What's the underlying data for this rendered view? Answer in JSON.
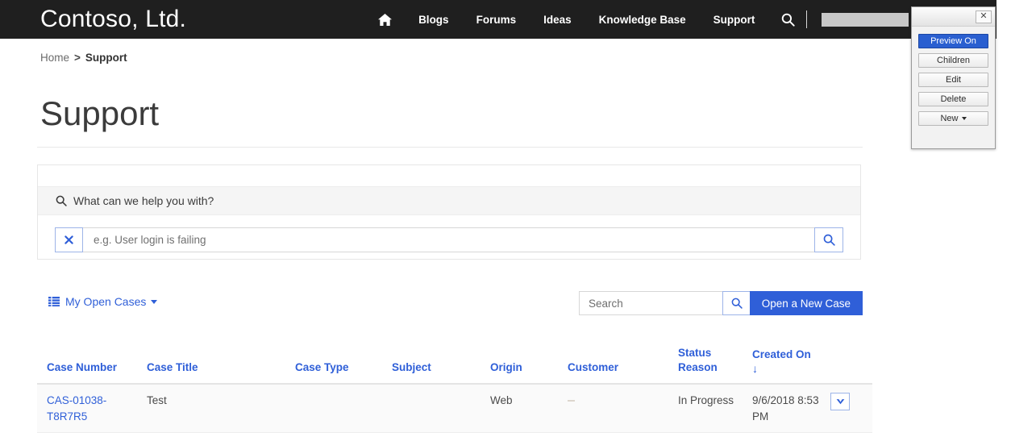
{
  "nav": {
    "brand": "Contoso, Ltd.",
    "home_icon": "home-icon",
    "links": [
      "Blogs",
      "Forums",
      "Ideas",
      "Knowledge Base",
      "Support"
    ],
    "search_icon": "search-icon",
    "user_label": "",
    "user_caret": "chevron-down-icon"
  },
  "breadcrumb": {
    "home": "Home",
    "separator": ">",
    "current": "Support"
  },
  "page": {
    "title": "Support"
  },
  "help": {
    "prompt_icon": "search-icon",
    "prompt": "What can we help you with?",
    "clear_icon": "close-x-icon",
    "input_value": "",
    "input_placeholder": "e.g. User login is failing",
    "search_icon": "search-icon"
  },
  "toolbar": {
    "view_icon": "list-icon",
    "view_label": "My Open Cases",
    "view_caret": "caret-down-icon",
    "search_value": "",
    "search_placeholder": "Search",
    "search_icon": "search-icon",
    "open_case_label": "Open a New Case"
  },
  "table": {
    "columns": [
      "Case Number",
      "Case Title",
      "Case Type",
      "Subject",
      "Origin",
      "Customer",
      "Status Reason",
      "Created On",
      ""
    ],
    "sorted_column": "Created On",
    "sort_arrow": "↓",
    "rows": [
      {
        "case_number": "CAS-01038-T8R7R5",
        "case_title": "Test",
        "case_type": "",
        "subject": "",
        "origin": "Web",
        "customer": "",
        "status_reason": "In Progress",
        "created_on": "9/6/2018 8:53 PM",
        "action_icon": "chevron-down-icon"
      }
    ]
  },
  "tool_panel": {
    "close_label": "✕",
    "buttons": [
      {
        "label": "Preview On",
        "active": true
      },
      {
        "label": "Children",
        "active": false
      },
      {
        "label": "Edit",
        "active": false
      },
      {
        "label": "Delete",
        "active": false
      },
      {
        "label": "New",
        "active": false,
        "caret": true
      }
    ]
  },
  "colors": {
    "nav_background": "#1f1f1f",
    "accent_blue": "#2f5fd8",
    "panel_active_blue": "#2a5fd0",
    "page_background": "#ffffff",
    "row_background": "#fafafa"
  }
}
